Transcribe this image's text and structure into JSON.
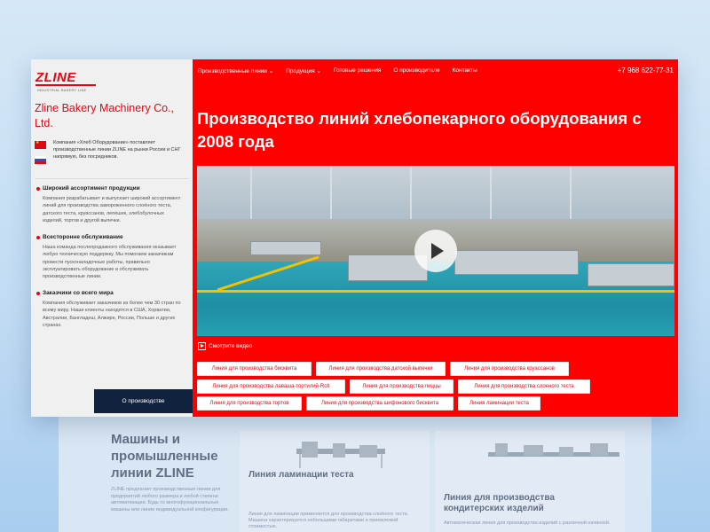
{
  "sidebar": {
    "logo_text": "ZLINE",
    "logo_subtitle": "INDUSTRIAL BAKERY LINE",
    "company_name": "Zline Bakery Machinery Co., Ltd.",
    "flag_note": "Компания «Хлеб Оборудование» поставляет производственные линии ZLINE на рынки России и СНГ напрямую, без посредников.",
    "features": [
      {
        "title": "Широкий ассортимент продукции",
        "text": "Компания разрабатывает и выпускает широкий ассортимент линий для производства замороженного слоёного теста, датского теста, круассанов, лепёшек, хлебобулочных изделий, тортов и другой выпечки."
      },
      {
        "title": "Всесторонне обслуживание",
        "text": "Наша команда послепродажного обслуживания оказывает любую техническую поддержку. Мы помогаем заказчикам провести пусконаладочные работы, правильно эксплуатировать оборудование и обслуживать производственные линии."
      },
      {
        "title": "Заказчики со всего мира",
        "text": "Компания обслуживает заказчиков из более чем 30 стран по всему миру. Наши клиенты находятся в США, Хорватии, Австралии, Бангладеш, Алжире, России, Польше и других странах."
      }
    ],
    "about_button": "О производстве"
  },
  "nav": {
    "items": [
      "Производственные линии ⌄",
      "Продукция ⌄",
      "Готовые решения",
      "О производителе",
      "Контакты"
    ],
    "phone": "+7 968 622-77-31"
  },
  "hero": {
    "title": "Производство линий хлебопекарного оборудования с 2008 года",
    "watch_video": "Смотрите видео"
  },
  "product_lines": [
    "Линия для производства бисквита",
    "Линия для производства датской выпечки",
    "Линия для производства круассанов",
    "Линия для производства лаваша-тортилий-Roti",
    "Линия для производства пиццы",
    "Линия для производства слоеного теста",
    "Линия для производства тортов",
    "Линия для производства шифонового бисквита",
    "Линия ламинации теста"
  ],
  "background_page": {
    "heading": "Машины и промышленные линии ZLINE",
    "intro": "ZLINE предлагает производственные линии для предприятий любого размера и любой степени автоматизации. Будь то многофункциональные машины или линии индивидуальной конфигурации.",
    "cards": [
      {
        "title": "Линия ламинации теста",
        "text": "Линия для ламинации применяется для производства слоёного теста. Машина характеризуется небольшими габаритами и приемлемой стоимостью."
      },
      {
        "title": "Линия для производства кондитерских изделий",
        "text": "Автоматическая линия для производства изделий с различной начинкой."
      }
    ]
  },
  "colors": {
    "brand_red": "#e30613",
    "hero_red": "#ff0000",
    "dark_button": "#11223e"
  }
}
